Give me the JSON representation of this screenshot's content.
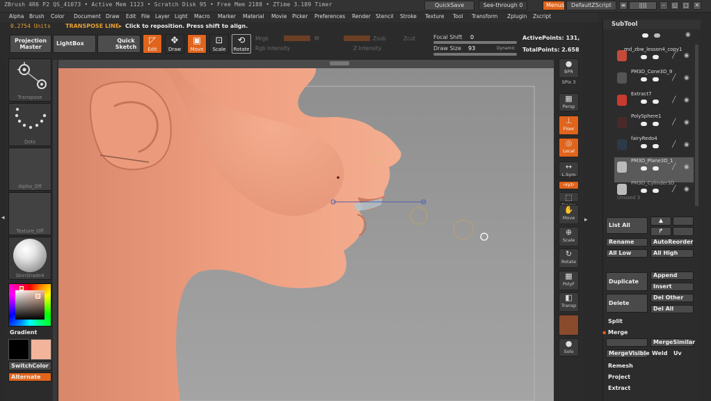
{
  "title_bar": {
    "info": "ZBrush 4R6 P2   QS_41073   • Active Mem 1123 • Scratch Disk 95 • Free Mem 2188 • ZTime 3.189 Timer",
    "quicksave": "QuickSave",
    "see_through": "See-through  0",
    "menus": "Menus",
    "script": "DefaultZScript"
  },
  "menu": [
    "Alpha",
    "Brush",
    "Color",
    "Document",
    "Draw",
    "Edit",
    "File",
    "Layer",
    "Light",
    "Macro",
    "Marker",
    "Material",
    "Movie",
    "Picker",
    "Preferences",
    "Render",
    "Stencil",
    "Stroke",
    "Texture",
    "Tool",
    "Transform",
    "Zplugin",
    "Zscript"
  ],
  "status": {
    "units": "0.2754 Units",
    "mode": "TRANSPOSE LINE▸",
    "hint": "Click to reposition. Press shift to align."
  },
  "shelf": {
    "projection_master": "Projection Master",
    "lightbox": "LightBox",
    "quick_sketch": "Quick Sketch",
    "edit": "Edit",
    "draw": "Draw",
    "move": "Move",
    "scale": "Scale",
    "rotate": "Rotate",
    "mrgb": "Mrgb",
    "m": "M",
    "zsub": "Zsub",
    "zcut": "Zcut",
    "rgb_intensity": "Rgb Intensity",
    "z_intensity": "Z Intensity",
    "focal_shift_label": "Focal Shift",
    "focal_shift_value": "0",
    "draw_size_label": "Draw Size",
    "draw_size_value": "93",
    "dynamic": "Dynamic",
    "active_points": "ActivePoints: 131,",
    "total_points": "TotalPoints: 2.658"
  },
  "left_panel": {
    "transpose": "Transpose",
    "dots": "Dots",
    "alpha_off": "Alpha_Off",
    "texture_off": "Texture_Off",
    "material": "SkinShade4",
    "gradient": "Gradient",
    "switch_color": "SwitchColor",
    "alternate": "Alternate",
    "colors": {
      "primary": "#000000",
      "secondary": "#f2b59c",
      "accent": "#e0641c"
    }
  },
  "right_toolbar": [
    {
      "name": "bpr-button",
      "label": "BPR",
      "icon": "●"
    },
    {
      "name": "spix-button",
      "label": "SPix 3",
      "icon": ""
    },
    {
      "name": "persp-button",
      "label": "Persp",
      "icon": "▦"
    },
    {
      "name": "floor-button",
      "label": "Floor",
      "icon": "⊥"
    },
    {
      "name": "local-button",
      "label": "Local",
      "icon": "◎"
    },
    {
      "name": "lsym-button",
      "label": "L.Sym",
      "icon": "↔"
    },
    {
      "name": "xyz-button",
      "label": "‹xyz›",
      "icon": ""
    },
    {
      "name": "frame-button",
      "label": "Frame",
      "icon": "⬚"
    },
    {
      "name": "move-view-button",
      "label": "Move",
      "icon": "✋"
    },
    {
      "name": "scale-view-button",
      "label": "Scale",
      "icon": "⊕"
    },
    {
      "name": "rotate-view-button",
      "label": "Rotate",
      "icon": "↻"
    },
    {
      "name": "polyf-button",
      "label": "PolyF",
      "icon": "▦"
    },
    {
      "name": "transp-button",
      "label": "Transp",
      "icon": "◧"
    },
    {
      "name": "ghost-button",
      "label": "",
      "icon": ""
    },
    {
      "name": "solo-button",
      "label": "Solo",
      "icon": "●"
    }
  ],
  "subtool": {
    "title": "SubTool",
    "items": [
      "md_zbw_lesson4_copy1",
      "PM3D_Cone3D_9",
      "Extract7",
      "PolySphere1",
      "fairyRedo4",
      "PM3D_Plane3D_1",
      "PM3D_Cylinder3D"
    ],
    "unused": "Unused  3",
    "list_all": "List All",
    "rename": "Rename",
    "auto_reorder": "AutoReorder",
    "all_low": "All Low",
    "all_high": "All High",
    "duplicate": "Duplicate",
    "append": "Append",
    "insert": "Insert",
    "delete": "Delete",
    "del_other": "Del Other",
    "del_all": "Del All",
    "split": "Split",
    "merge": "Merge",
    "merge_similar": "MergeSimilar",
    "merge_visible": "MergeVisible",
    "weld": "Weld",
    "uv": "Uv",
    "remesh": "Remesh",
    "project": "Project",
    "extract": "Extract"
  }
}
